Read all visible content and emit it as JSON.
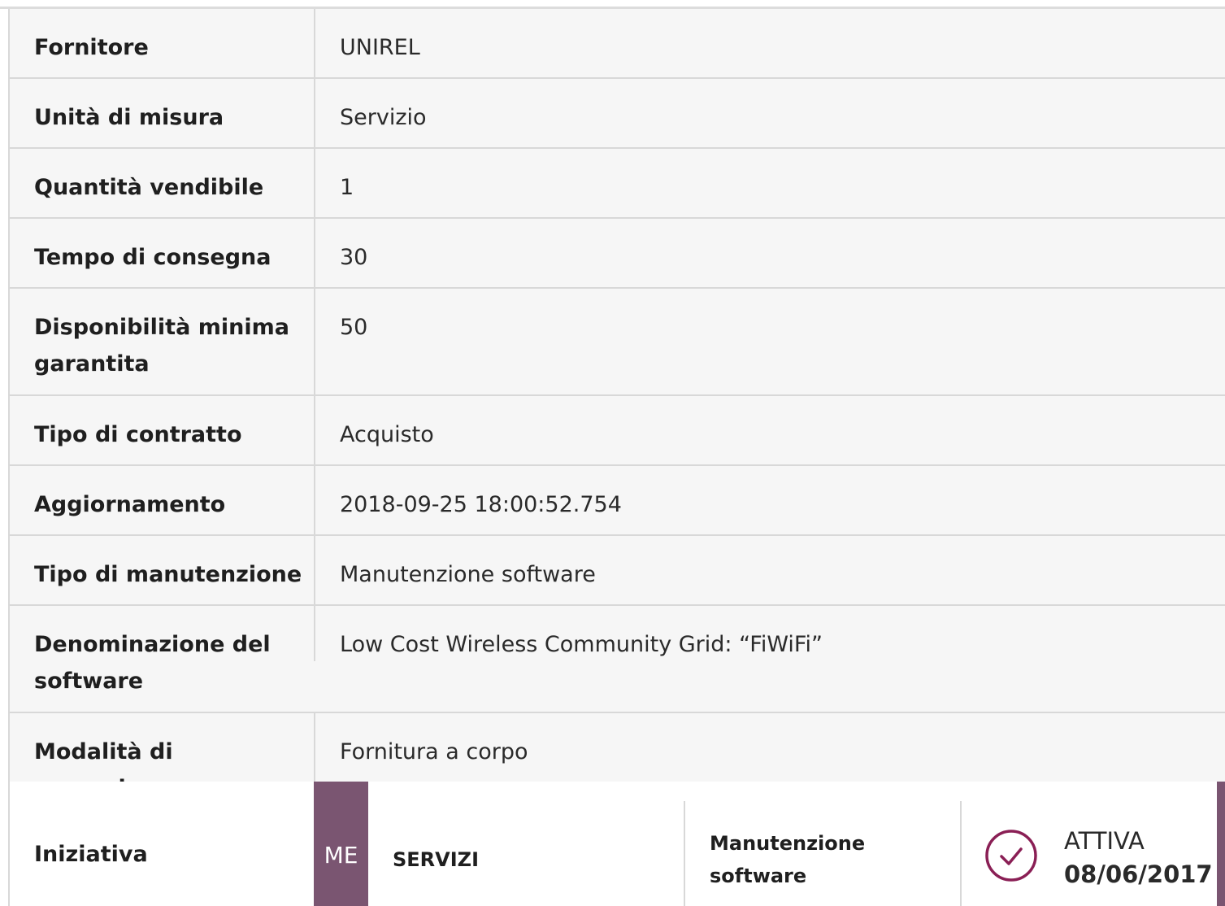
{
  "rows": [
    {
      "label": "Fornitore",
      "value": "UNIREL"
    },
    {
      "label": "Unità di misura",
      "value": "Servizio"
    },
    {
      "label": "Quantità vendibile",
      "value": "1"
    },
    {
      "label": "Tempo di consegna",
      "value": "30"
    },
    {
      "label": "Disponibilità minima garantita",
      "value": "50"
    },
    {
      "label": "Tipo di contratto",
      "value": "Acquisto"
    },
    {
      "label": "Aggiornamento",
      "value": "2018-09-25 18:00:52.754"
    },
    {
      "label": "Tipo di manutenzione",
      "value": "Manutenzione software"
    },
    {
      "label": "Denominazione del software",
      "value": "Low Cost Wireless Community Grid: “FiWiFi”"
    },
    {
      "label": "Modalità di erogazione",
      "value": "Fornitura a corpo"
    }
  ],
  "initiative": {
    "label": "Iniziativa",
    "badge": "ME",
    "category": "SERVIZI",
    "subcategory": "Manutenzione software",
    "status": "ATTIVA",
    "date": "08/06/2017",
    "badge_color": "#7a5571",
    "status_icon": "check-circle-icon"
  }
}
